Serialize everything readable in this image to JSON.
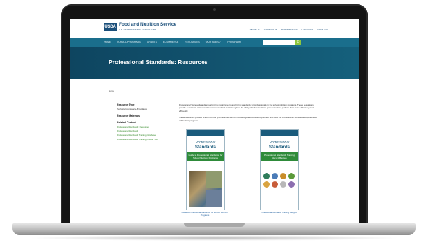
{
  "site": {
    "logo_text": "USDA",
    "agency": "Food and Nutrition Service",
    "department": "U.S. DEPARTMENT OF AGRICULTURE",
    "util_links": [
      "ABOUT US",
      "CONTACT US",
      "REPORT FRAUD",
      "LANGUAGE",
      "USDA.GOV"
    ]
  },
  "nav": {
    "items": [
      "HOME",
      "FOR ALL PROGRAMS",
      "GRANTS",
      "ECOMMERCE",
      "RESOURCES",
      "OUR AGENCY",
      "PROGRAMS"
    ],
    "search_placeholder": "",
    "search_button": "Q"
  },
  "banner": {
    "title": "Professional Standards: Resources"
  },
  "breadcrumb": "Home",
  "sidebar": {
    "resource_type_heading": "Resource Type",
    "resource_type_value": "Technical Assistance & Guidance",
    "resource_materials_heading": "Resource Materials",
    "related_heading": "Related Content",
    "related_links": [
      "Professional Standards: Resources",
      "Professional Standards",
      "Professional Standards Training Database",
      "Professional Standards Training Tracker Tool"
    ]
  },
  "main": {
    "para1": "Professional Standards and annual training requirements and hiring standards for professionals in the school nutrition programs. These regulations provide consistent, national professional standards that strengthen the ability of school nutrition professionals to perform their duties effectively and efficiently.",
    "para2": "These resources provide school nutrition professionals with the knowledge and tools to implement and meet the Professional Standards Requirements within their programs."
  },
  "cards": [
    {
      "brand_line1": "Professional",
      "brand_line2": "Standards",
      "band_text": "Guide to Professional Standards for School Nutrition Programs",
      "caption": "Guide to Professional Standards for School Nutrition Programs"
    },
    {
      "brand_line1": "Professional",
      "brand_line2": "Standards",
      "band_text": "Professional Standards Training Record Badges",
      "caption": "Professional Standards Training Badges"
    }
  ],
  "badge_colors": [
    "#2e7d5b",
    "#4a7bb7",
    "#c98d2a",
    "#5a9a3a",
    "#d9a441",
    "#c85d3a",
    "#b8b8b8",
    "#8c6fb0"
  ],
  "colors": {
    "nav_bar": "#1a6e8c",
    "banner": "#104a66",
    "accent_green": "#8dc63f",
    "link_green": "#3a8d2f"
  }
}
